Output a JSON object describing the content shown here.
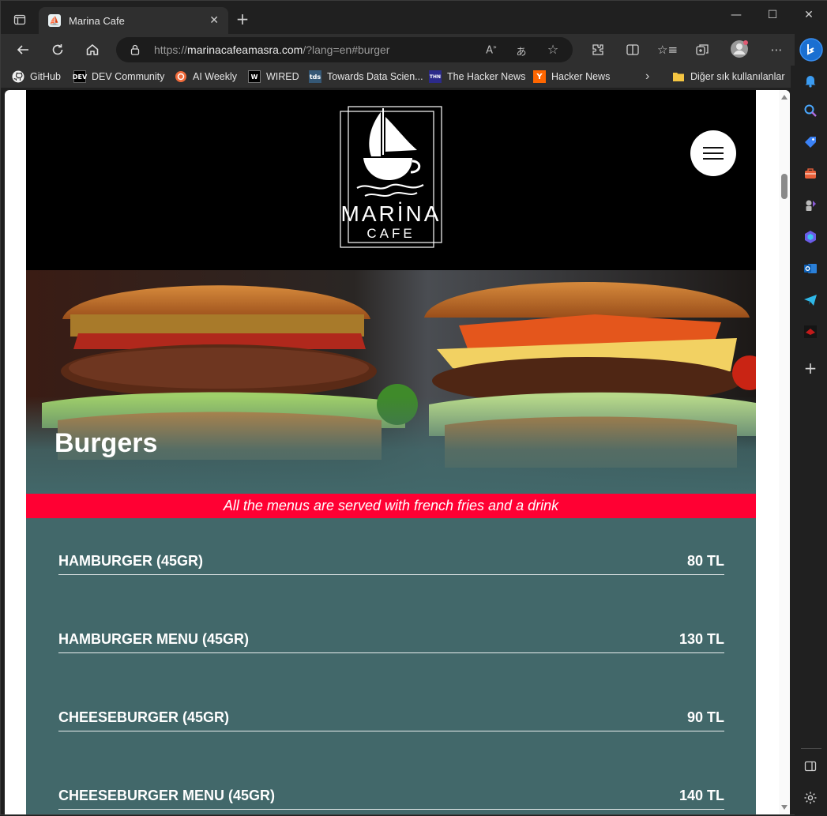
{
  "browser": {
    "tab": {
      "title": "Marina Cafe"
    },
    "url": {
      "prefix": "https://",
      "host": "marinacafeamasra.com",
      "path": "/?lang=en#burger"
    },
    "bookmarks": [
      {
        "label": "GitHub",
        "icon": "github-icon"
      },
      {
        "label": "DEV Community",
        "icon": "dev-icon",
        "badge": "DEV"
      },
      {
        "label": "AI Weekly",
        "icon": "ai-weekly-icon"
      },
      {
        "label": "WIRED",
        "icon": "wired-icon"
      },
      {
        "label": "Towards Data Scien...",
        "icon": "tds-icon",
        "badge": "tds"
      },
      {
        "label": "The Hacker News",
        "icon": "thn-icon",
        "badge": "THN"
      },
      {
        "label": "Hacker News",
        "icon": "hn-icon",
        "badge": "Y"
      }
    ],
    "other_bookmarks": "Diğer sık kullanılanlar"
  },
  "site": {
    "logo": {
      "line1": "MARİNA",
      "line2": "CAFE"
    },
    "section_title": "Burgers",
    "notice": "All the menus are served with french fries and a drink",
    "items": [
      {
        "name": "HAMBURGER (45GR)",
        "price": "80 TL"
      },
      {
        "name": "HAMBURGER MENU (45GR)",
        "price": "130 TL"
      },
      {
        "name": "CHEESEBURGER (45GR)",
        "price": "90 TL"
      },
      {
        "name": "CHEESEBURGER MENU (45GR)",
        "price": "140 TL"
      }
    ]
  },
  "colors": {
    "accent_red": "#ff0033",
    "teal": "#42686a",
    "header_black": "#000000"
  }
}
